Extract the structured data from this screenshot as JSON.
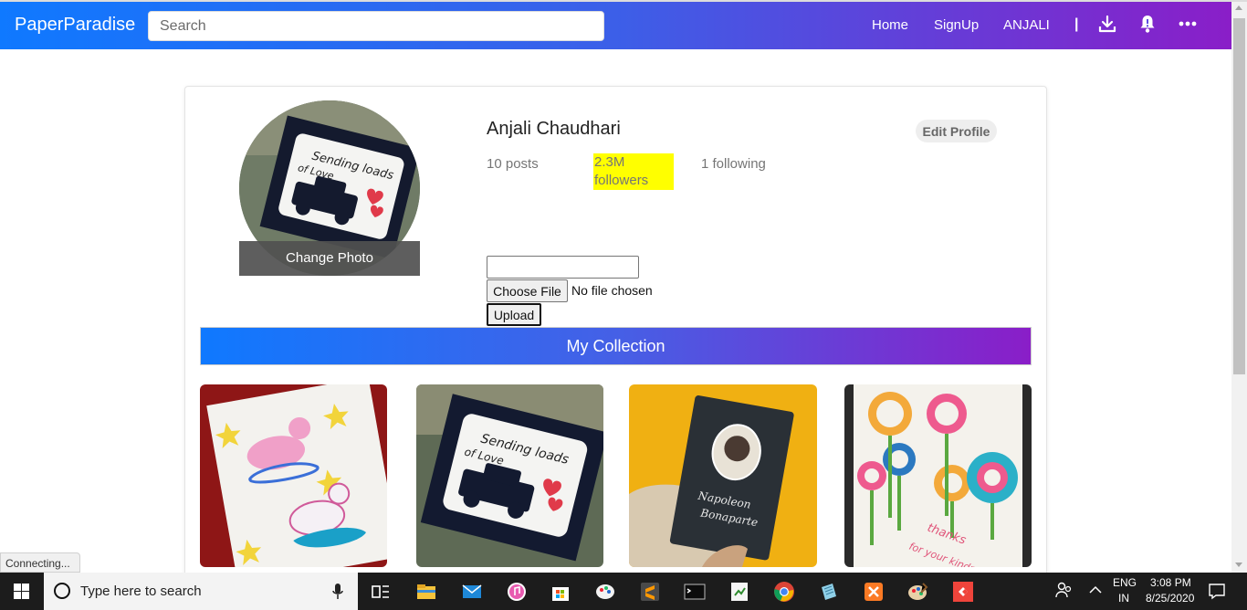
{
  "navbar": {
    "brand": "PaperParadise",
    "search_placeholder": "Search",
    "links": [
      "Home",
      "SignUp",
      "ANJALI"
    ],
    "separator": "|",
    "icons": [
      "download-icon",
      "bell-icon",
      "more-horizontal-icon"
    ]
  },
  "profile": {
    "name": "Anjali Chaudhari",
    "edit_label": "Edit Profile",
    "posts": "10 posts",
    "followers": "2.3M followers",
    "following": "1 following",
    "change_photo": "Change Photo",
    "choose_file": "Choose File",
    "no_file": "No file chosen",
    "upload": "Upload"
  },
  "collection": {
    "title": "My Collection",
    "items": [
      {
        "subject": "unicorn-card"
      },
      {
        "subject": "sending-loads-of-love-car-card"
      },
      {
        "subject": "portrait-bookmark-card"
      },
      {
        "subject": "thanks-for-your-kindness-flower-card"
      }
    ]
  },
  "status": {
    "connecting": "Connecting..."
  },
  "taskbar": {
    "search_placeholder": "Type here to search",
    "lang_top": "ENG",
    "lang_bottom": "IN",
    "time": "3:08 PM",
    "date": "8/25/2020"
  },
  "colors": {
    "gradient_start": "#0f79ff",
    "gradient_end": "#8a1ec8",
    "highlight": "#ffff00"
  }
}
